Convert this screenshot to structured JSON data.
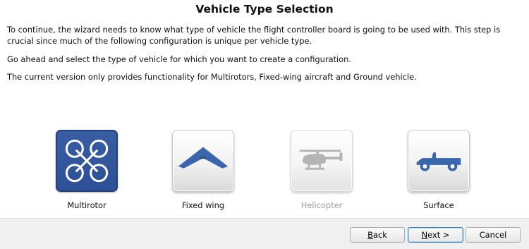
{
  "page": {
    "title": "Vehicle Type Selection",
    "paragraphs": [
      "To continue, the wizard needs to know what type of vehicle the flight controller board is going to be used with. This step is crucial since much of the following configuration is unique per vehicle type.",
      "Go ahead and select the type of vehicle for which you want to create a configuration.",
      "The current version only provides functionality for Multirotors, Fixed-wing aircraft and Ground vehicle."
    ]
  },
  "vehicles": [
    {
      "label": "Multirotor",
      "icon": "multirotor-icon",
      "selected": true,
      "enabled": true
    },
    {
      "label": "Fixed wing",
      "icon": "fixed-wing-icon",
      "selected": false,
      "enabled": true
    },
    {
      "label": "Helicopter",
      "icon": "helicopter-icon",
      "selected": false,
      "enabled": false
    },
    {
      "label": "Surface",
      "icon": "surface-vehicle-icon",
      "selected": false,
      "enabled": true
    }
  ],
  "buttons": {
    "back": {
      "mnemonic": "B",
      "rest": "ack"
    },
    "next": {
      "mnemonic": "N",
      "rest": "ext >"
    },
    "cancel": "Cancel"
  },
  "colors": {
    "selected_bg": "#2f5399",
    "icon_blue": "#3a66ad",
    "disabled_gray": "#9a9a9a"
  }
}
